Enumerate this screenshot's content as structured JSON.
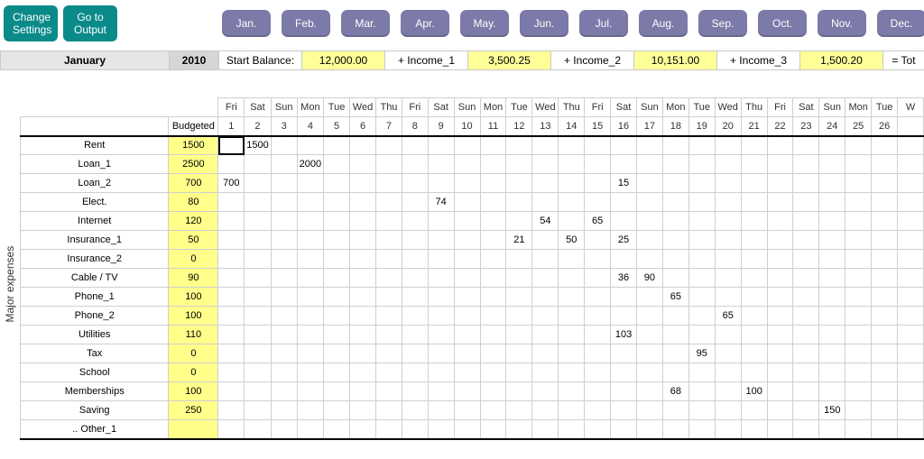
{
  "buttons": {
    "change_settings": "Change\nSettings",
    "go_output": "Go to\nOutput"
  },
  "months": [
    "Jan.",
    "Feb.",
    "Mar.",
    "Apr.",
    "May.",
    "Jun.",
    "Jul.",
    "Aug.",
    "Sep.",
    "Oct.",
    "Nov.",
    "Dec."
  ],
  "summary": {
    "month_name": "January",
    "year": "2010",
    "start_balance_label": "Start Balance:",
    "start_balance": "12,000.00",
    "income1_label": "+ Income_1",
    "income1": "3,500.25",
    "income2_label": "+ Income_2",
    "income2": "10,151.00",
    "income3_label": "+ Income_3",
    "income3": "1,500.20",
    "total_label": "= Tot"
  },
  "section_label": "Major expenses",
  "header_budgeted": "Budgeted",
  "day_names": [
    "Fri",
    "Sat",
    "Sun",
    "Mon",
    "Tue",
    "Wed",
    "Thu",
    "Fri",
    "Sat",
    "Sun",
    "Mon",
    "Tue",
    "Wed",
    "Thu",
    "Fri",
    "Sat",
    "Sun",
    "Mon",
    "Tue",
    "Wed",
    "Thu",
    "Fri",
    "Sat",
    "Sun",
    "Mon",
    "Tue",
    "W"
  ],
  "day_nums": [
    "1",
    "2",
    "3",
    "4",
    "5",
    "6",
    "7",
    "8",
    "9",
    "10",
    "11",
    "12",
    "13",
    "14",
    "15",
    "16",
    "17",
    "18",
    "19",
    "20",
    "21",
    "22",
    "23",
    "24",
    "25",
    "26",
    ""
  ],
  "rows": [
    {
      "label": "Rent",
      "budget": "1500",
      "cells": {
        "2": "1500"
      }
    },
    {
      "label": "Loan_1",
      "budget": "2500",
      "cells": {
        "4": "2000"
      }
    },
    {
      "label": "Loan_2",
      "budget": "700",
      "cells": {
        "1": "700",
        "16": "15"
      }
    },
    {
      "label": "Elect.",
      "budget": "80",
      "cells": {
        "9": "74"
      }
    },
    {
      "label": "Internet",
      "budget": "120",
      "cells": {
        "13": "54",
        "15": "65"
      }
    },
    {
      "label": "Insurance_1",
      "budget": "50",
      "cells": {
        "12": "21",
        "14": "50",
        "16": "25"
      }
    },
    {
      "label": "Insurance_2",
      "budget": "0",
      "cells": {}
    },
    {
      "label": "Cable / TV",
      "budget": "90",
      "cells": {
        "16": "36",
        "17": "90"
      }
    },
    {
      "label": "Phone_1",
      "budget": "100",
      "cells": {
        "18": "65"
      }
    },
    {
      "label": "Phone_2",
      "budget": "100",
      "cells": {
        "20": "65"
      }
    },
    {
      "label": "Utilities",
      "budget": "110",
      "cells": {
        "16": "103"
      }
    },
    {
      "label": "Tax",
      "budget": "0",
      "cells": {
        "19": "95"
      }
    },
    {
      "label": "School",
      "budget": "0",
      "cells": {}
    },
    {
      "label": "Memberships",
      "budget": "100",
      "cells": {
        "18": "68",
        "21": "100"
      }
    },
    {
      "label": "Saving",
      "budget": "250",
      "cells": {
        "24": "150"
      }
    },
    {
      "label": ".. Other_1",
      "budget": "",
      "cells": {}
    }
  ]
}
